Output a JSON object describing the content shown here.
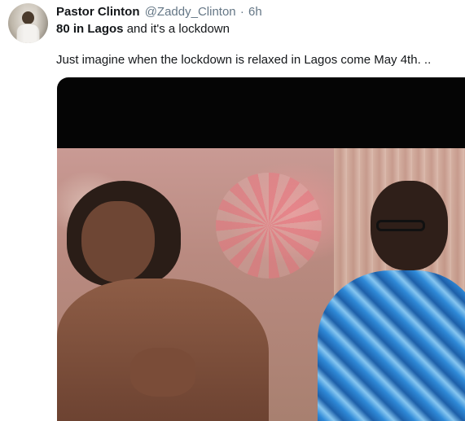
{
  "tweet": {
    "author_name": "Pastor Clinton",
    "author_handle": "@Zaddy_Clinton",
    "separator": "·",
    "time": "6h",
    "line1_bold": "80 in Lagos",
    "line1_rest": " and it's a lockdown",
    "line2": "Just imagine when the lockdown is relaxed in Lagos come May 4th. .."
  },
  "colors": {
    "text": "#14171a",
    "secondary": "#657786",
    "media_bg": "#050505"
  },
  "icons": {
    "avatar": "profile-photo",
    "media": "video-thumbnail"
  }
}
